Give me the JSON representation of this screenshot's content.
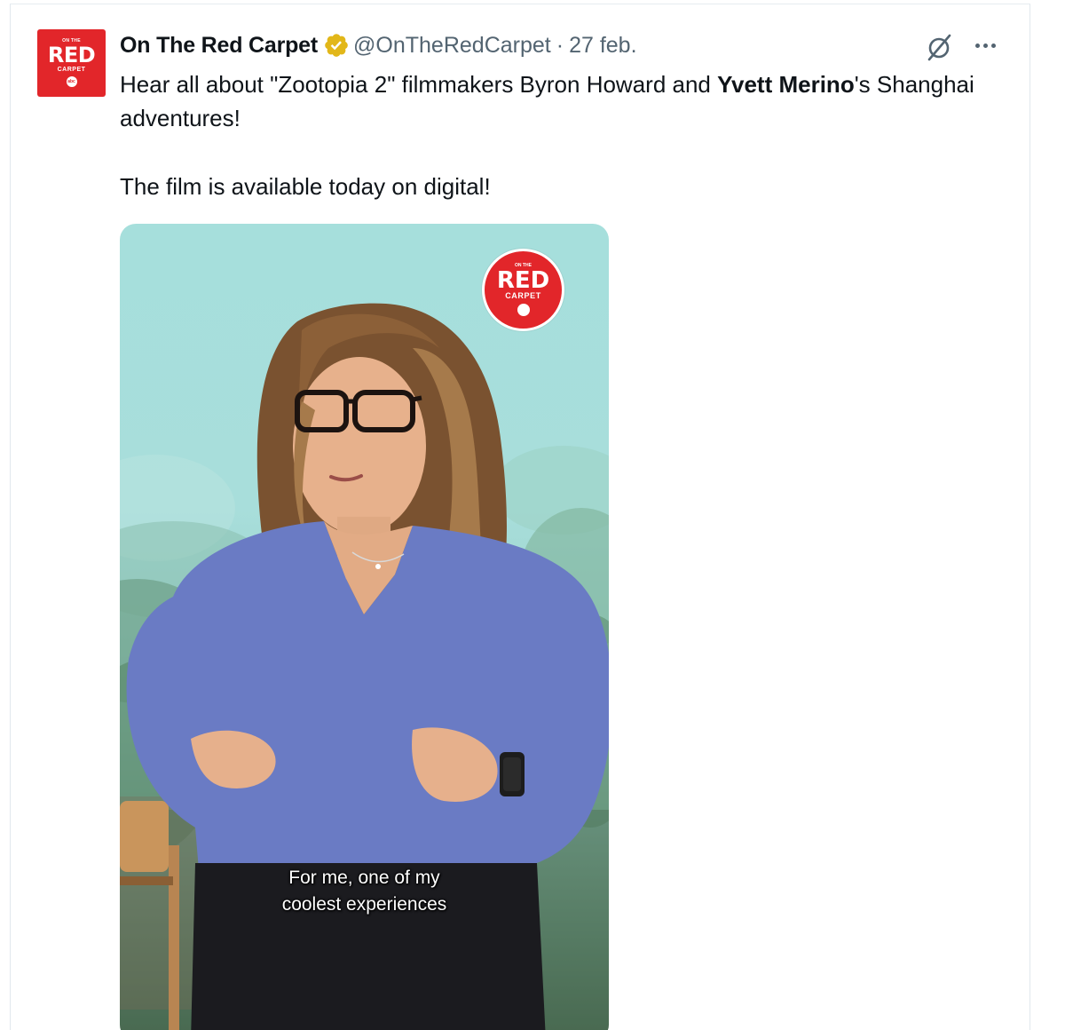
{
  "tweet": {
    "author_name": "On The Red Carpet",
    "handle": "@OnTheRedCarpet",
    "separator": "·",
    "date": "27 feb.",
    "avatar": {
      "small_text": "ON THE",
      "big_text": "RED",
      "sub_text": "CARPET",
      "network": "abc"
    },
    "text": {
      "part1": "Hear all about \"Zootopia 2\" filmmakers Byron Howard and ",
      "bold": "Yvett Merino",
      "part2": "'s Shanghai adventures!",
      "line2": "The film is available today on digital!"
    },
    "icons": {
      "verified": "verified-badge-icon",
      "grok": "grok-icon",
      "more": "more-options-icon"
    },
    "video": {
      "logo_small": "ON THE",
      "logo_big": "RED",
      "logo_sub": "CARPET",
      "caption_line1": "For me, one of my",
      "caption_line2": "coolest experiences"
    }
  },
  "colors": {
    "brand_red": "#e2262a",
    "verified_gold": "#e2b719",
    "muted_text": "#536471",
    "sweater": "#6a7bc4"
  }
}
